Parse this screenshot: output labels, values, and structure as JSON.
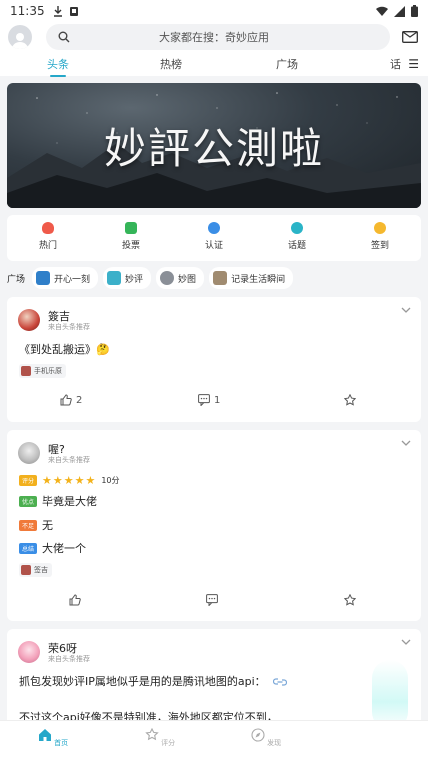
{
  "status": {
    "time": "11:35"
  },
  "topbar": {
    "search_placeholder": "大家都在搜：奇妙应用"
  },
  "tabs": [
    "头条",
    "热榜",
    "广场",
    "话"
  ],
  "banner": {
    "title": "妙評公測啦"
  },
  "quick": [
    {
      "label": "热门",
      "color": "#ef5a4a"
    },
    {
      "label": "投票",
      "color": "#35b559"
    },
    {
      "label": "认证",
      "color": "#3a8ee6"
    },
    {
      "label": "话题",
      "color": "#2ab4c7"
    },
    {
      "label": "签到",
      "color": "#f5b82e"
    }
  ],
  "plaza": {
    "label": "广场",
    "chips": [
      {
        "label": "开心一刻",
        "color": "#2f7fc9"
      },
      {
        "label": "妙评",
        "color": "#3bb0c9"
      },
      {
        "label": "妙图",
        "color": "#8a8f97"
      },
      {
        "label": "记录生活瞬间",
        "color": "#a08b70"
      }
    ]
  },
  "posts": [
    {
      "user": "簽吉",
      "source": "来自头条推荐",
      "text": "《到处乱搬运》🤔",
      "tag": "手机乐原",
      "likes": "2",
      "comments": "1"
    },
    {
      "user": "喔?",
      "source": "来自头条推荐",
      "rating_badge": "评分",
      "rating_score": "10分",
      "pros_badge": "优点",
      "pros_text": "毕竟是大佬",
      "cons_badge": "不足",
      "cons_text": "无",
      "summary_badge": "总结",
      "summary_text": "大佬一个",
      "tag": "签吉"
    },
    {
      "user": "荣6呀",
      "source": "来自头条推荐",
      "line1": "抓包发现妙评IP属地似乎是用的是腾讯地图的api：",
      "line2": "不过这个api好像不是特别准，海外地区都定位不到，"
    }
  ],
  "bottomnav": [
    "首页",
    "评分",
    "发现"
  ]
}
